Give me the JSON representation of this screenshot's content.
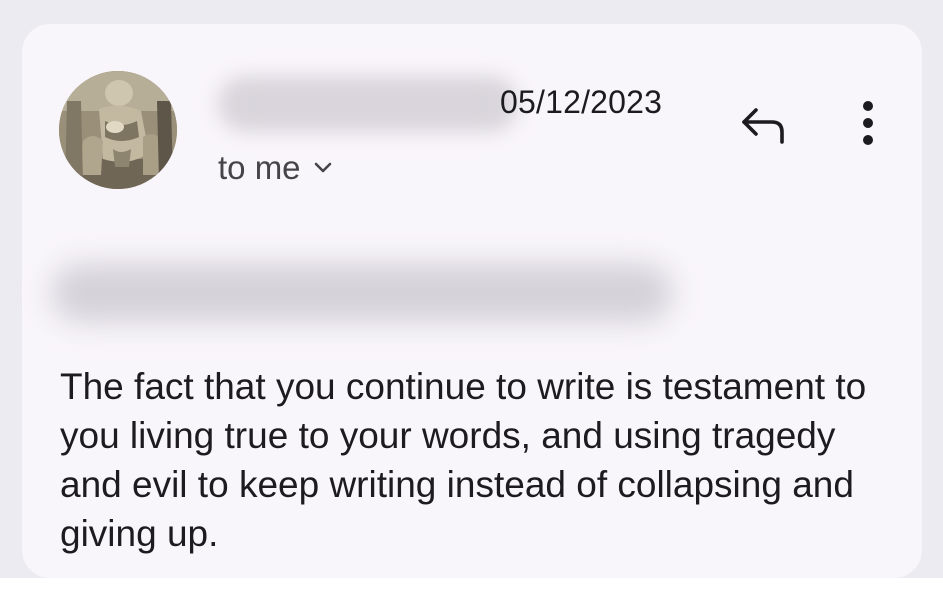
{
  "email": {
    "sender": {
      "avatar_icon": "profile-photo-statue",
      "name_redacted": true
    },
    "date": "05/12/2023",
    "recipient": {
      "label": "to me",
      "expand_icon": "chevron-down-icon"
    },
    "actions": [
      {
        "icon": "reply-icon"
      },
      {
        "icon": "more-vertical-icon"
      }
    ],
    "subject_redacted": true,
    "body": "The fact that you continue to write is testament to you living true to your words, and using tragedy and evil to keep writing instead of collapsing and giving up."
  },
  "colors": {
    "page_background": "#ecebf1",
    "card_background": "#f8f5fb",
    "primary_text": "#1c1b1f",
    "secondary_text": "#46444b"
  }
}
